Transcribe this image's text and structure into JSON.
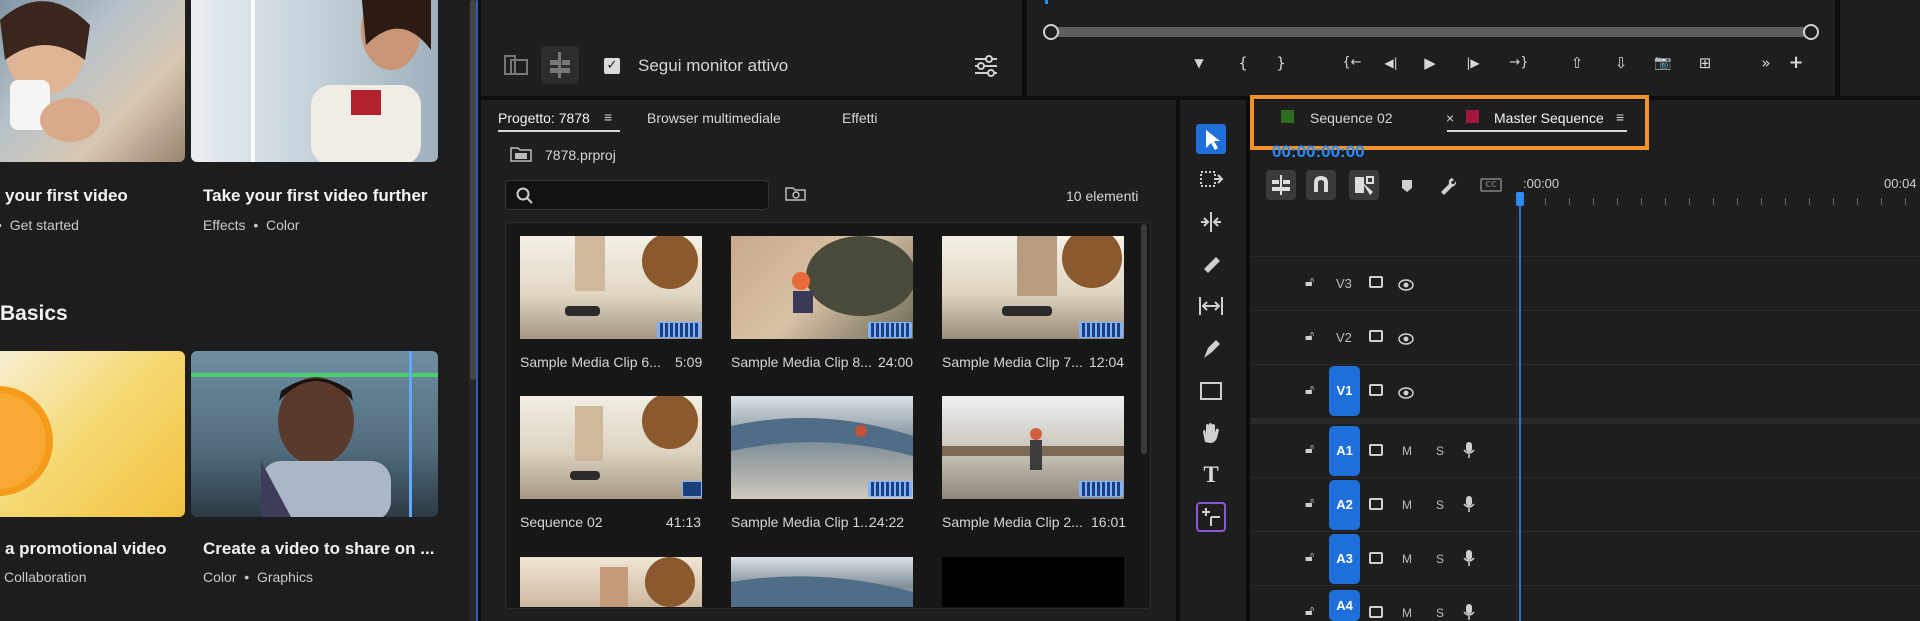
{
  "learn": {
    "cards_row1": [
      {
        "title": "your first video",
        "tags": [
          "Get started"
        ]
      },
      {
        "title": "Take your first video further",
        "tags": [
          "Effects",
          "Color"
        ]
      }
    ],
    "section_title": "Basics",
    "cards_row2": [
      {
        "title": "a promotional video",
        "tags": [
          "Collaboration"
        ]
      },
      {
        "title": "Create a video to share on ...",
        "tags": [
          "Color",
          "Graphics"
        ]
      }
    ],
    "tag_separator": "•"
  },
  "bin_top": {
    "follow_label": "Segui monitor attivo",
    "checkbox_mark": "✓"
  },
  "program": {
    "controls": [
      "▼",
      "{",
      "}",
      "{←",
      "◀|",
      "▶",
      "|▶",
      "→}",
      "⇧",
      "⇩",
      "📷",
      "⊞",
      "»",
      "+"
    ]
  },
  "project": {
    "tabs": [
      {
        "label": "Progetto: 7878",
        "menu": "≡"
      },
      {
        "label": "Browser multimediale"
      },
      {
        "label": "Effetti"
      }
    ],
    "file": "7878.prproj",
    "search": {
      "placeholder": ""
    },
    "item_count": "10 elementi",
    "clips": [
      {
        "name": "Sample Media Clip 6...",
        "duration": "5:09"
      },
      {
        "name": "Sample Media Clip 8...",
        "duration": "24:00"
      },
      {
        "name": "Sample Media Clip 7...",
        "duration": "12:04"
      },
      {
        "name": "Sequence 02",
        "duration": "41:13"
      },
      {
        "name": "Sample Media Clip 1...",
        "duration": "24:22"
      },
      {
        "name": "Sample Media Clip 2...",
        "duration": "16:01"
      },
      {
        "name": "",
        "duration": ""
      },
      {
        "name": "",
        "duration": ""
      },
      {
        "name": "",
        "duration": ""
      }
    ]
  },
  "tools": [
    "selection-tool",
    "track-select-tool",
    "ripple-edit-tool",
    "razor-tool",
    "slip-tool",
    "pen-tool",
    "rectangle-tool",
    "hand-tool",
    "type-tool",
    "generative-extend-tool"
  ],
  "timeline": {
    "tabs": [
      {
        "label": "Sequence 02",
        "color": "#2e6b1f",
        "close": "×"
      },
      {
        "label": "Master Sequence",
        "color": "#a3163d",
        "menu": "≡"
      }
    ],
    "timecode": "00:00:00:00",
    "ruler_start": ":00:00",
    "ruler_end": "00:04",
    "video_tracks": [
      {
        "name": "V3",
        "targeted": false
      },
      {
        "name": "V2",
        "targeted": false
      },
      {
        "name": "V1",
        "targeted": true
      }
    ],
    "audio_tracks": [
      {
        "name": "A1",
        "m": "M",
        "s": "S"
      },
      {
        "name": "A2",
        "m": "M",
        "s": "S"
      },
      {
        "name": "A3",
        "m": "M",
        "s": "S"
      },
      {
        "name": "A4",
        "m": "M",
        "s": "S"
      }
    ]
  },
  "colors": {
    "accent_blue": "#2b8cff",
    "highlight_orange": "#f0932b",
    "target_blue": "#1f6fdb"
  }
}
